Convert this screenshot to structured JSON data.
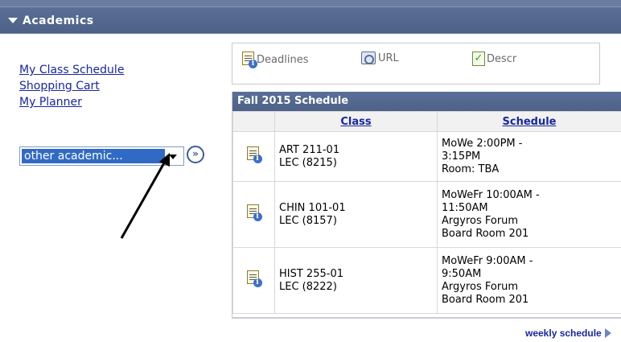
{
  "header": {
    "title": "Academics"
  },
  "links": [
    {
      "label": "My Class Schedule"
    },
    {
      "label": "Shopping Cart"
    },
    {
      "label": "My Planner"
    }
  ],
  "select": {
    "value": "other academic...",
    "go_label": "»"
  },
  "legend": {
    "deadlines": "Deadlines",
    "url": "URL",
    "descr": "Descr"
  },
  "schedule": {
    "title": "Fall 2015 Schedule",
    "columns": {
      "class": "Class",
      "schedule": "Schedule"
    },
    "rows": [
      {
        "class_line1": "ART 211-01",
        "class_line2": "LEC (8215)",
        "sched": [
          "MoWe 2:00PM -",
          "3:15PM",
          "Room:  TBA",
          ""
        ]
      },
      {
        "class_line1": "CHIN 101-01",
        "class_line2": "LEC (8157)",
        "sched": [
          "MoWeFr 10:00AM -",
          "11:50AM",
          "Argyros Forum",
          "Board Room 201"
        ]
      },
      {
        "class_line1": "HIST 255-01",
        "class_line2": "LEC (8222)",
        "sched": [
          "MoWeFr 9:00AM -",
          "9:50AM",
          "Argyros Forum",
          "Board Room 201"
        ]
      }
    ]
  },
  "footer": {
    "weekly_label": "weekly schedule"
  },
  "colors": {
    "header": "#4d6189",
    "link": "#17279f",
    "select_highlight": "#316ac5"
  },
  "icons": [
    "triangle-down-icon",
    "deadline-calendar-icon",
    "url-icon",
    "descr-check-icon",
    "double-chevron-right-icon",
    "arrow-right-icon"
  ]
}
